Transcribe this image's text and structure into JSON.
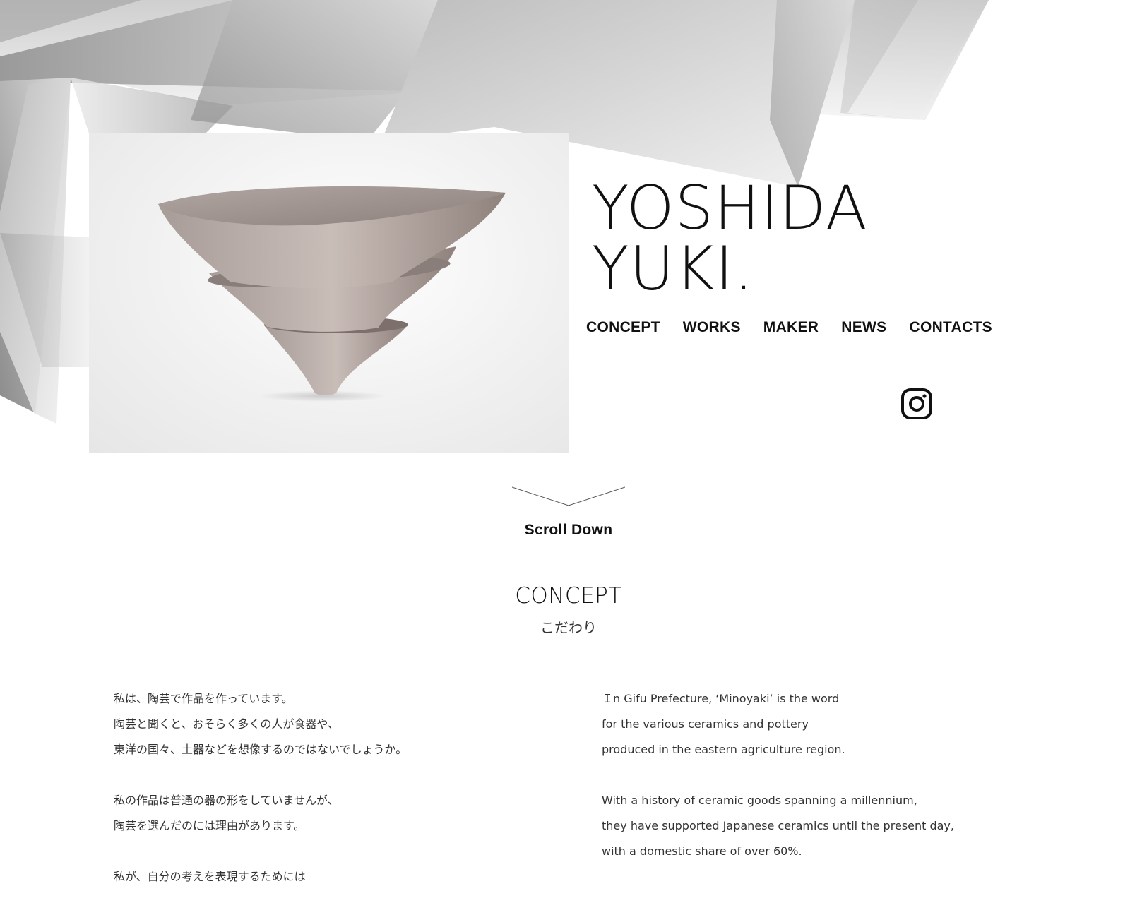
{
  "brand": {
    "line1": "YOSHIDA",
    "line2": "YUKI."
  },
  "nav": [
    {
      "label": "CONCEPT"
    },
    {
      "label": "WORKS"
    },
    {
      "label": "MAKER"
    },
    {
      "label": "NEWS"
    },
    {
      "label": "CONTACTS"
    }
  ],
  "social": {
    "icon": "instagram-icon"
  },
  "hero": {
    "image": "stacked-ceramic-vessels-photo"
  },
  "scroll": {
    "label": "Scroll Down",
    "icon": "chevron-down-icon"
  },
  "concept": {
    "title": "CONCEPT",
    "subtitle": "こだわり",
    "jp_paragraphs": [
      [
        "私は、陶芸で作品を作っています。",
        "陶芸と聞くと、おそらく多くの人が食器や、",
        "東洋の国々、土器などを想像するのではないでしょうか。"
      ],
      [
        "私の作品は普通の器の形をしていませんが、",
        "陶芸を選んだのには理由があります。"
      ],
      [
        "私が、自分の考えを表現するためには"
      ]
    ],
    "en_paragraphs": [
      [
        "Ｉn Gifu Prefecture, ‘Minoyaki’ is the word",
        "for the various ceramics and pottery",
        "produced in the eastern agriculture region."
      ],
      [
        "With a history of ceramic goods spanning a millennium,",
        "they have supported Japanese ceramics until the present day,",
        "with a domestic share of over 60%."
      ]
    ]
  },
  "colors": {
    "text": "#111111",
    "background": "#ffffff",
    "shape_dark": "#8a8a8a",
    "shape_light": "#e8e8e8"
  }
}
